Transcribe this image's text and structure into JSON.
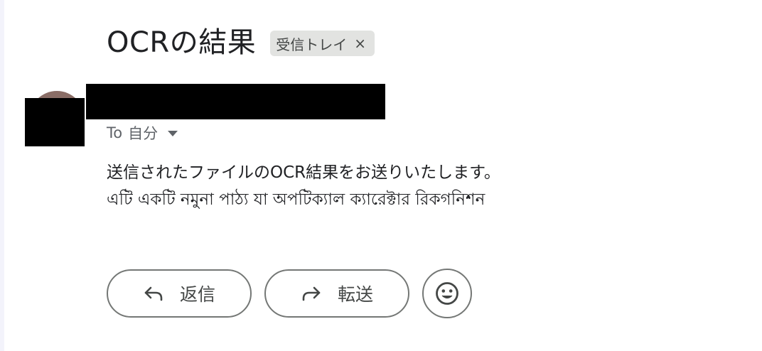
{
  "email": {
    "subject": "OCRの結果",
    "label_chip": {
      "text": "受信トレイ",
      "remove_glyph": "×"
    },
    "recipient": {
      "prefix": "To",
      "name": "自分"
    },
    "body_lines": [
      "送信されたファイルのOCR結果をお送りいたします。",
      "এটি একটি নমুনা পাঠ্য যা অপটিক্যাল ক্যারেক্টার রিকগনিশন"
    ]
  },
  "actions": {
    "reply_label": "返信",
    "forward_label": "転送"
  },
  "icons": {
    "reply": "reply-icon",
    "forward": "forward-icon",
    "emoji": "emoji-icon",
    "caret": "chevron-down-icon"
  },
  "colors": {
    "chip_bg": "#e2e3e1",
    "button_border": "#747775",
    "secondary_text": "#5f6368",
    "primary_text": "#202124"
  }
}
